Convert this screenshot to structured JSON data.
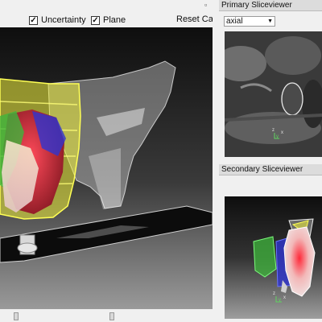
{
  "main_panel": {
    "checkboxes": [
      {
        "label": "Uncertainty",
        "checked": true
      },
      {
        "label": "Plane",
        "checked": true
      }
    ],
    "reset_camera_label": "Reset Camera",
    "reset_icon": "reset-camera-icon",
    "float_icon": "float-window-icon",
    "close_icon": "close-icon"
  },
  "primary_sliceviewer": {
    "title": "Primary Sliceviewer",
    "orientation_selected": "axial",
    "axis_labels": {
      "z": "z",
      "y": "y",
      "x": "x"
    }
  },
  "secondary_sliceviewer": {
    "title": "Secondary Sliceviewer",
    "axis_labels": {
      "z": "z",
      "y": "y",
      "x": "x"
    }
  },
  "colors": {
    "panel_bg": "#f0f0f0",
    "title_bg": "#dcdcdc",
    "uncertainty_yellow": "#f2f23a",
    "bladder_red": "#e0303a",
    "structure_green": "#3fb53c",
    "structure_blue": "#2f35d0"
  }
}
